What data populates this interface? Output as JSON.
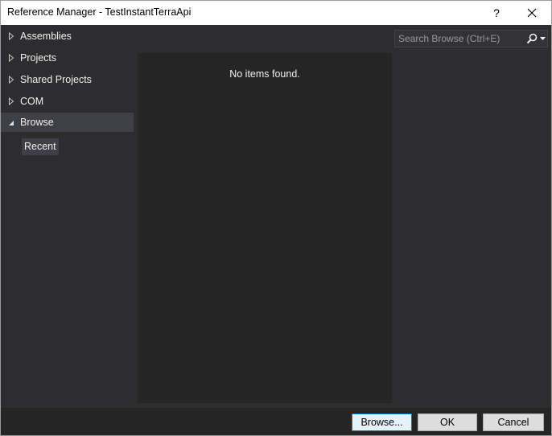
{
  "window": {
    "title": "Reference Manager - TestInstantTerraApi",
    "help_label": "?"
  },
  "tree": {
    "items": [
      {
        "label": "Assemblies",
        "expanded": false
      },
      {
        "label": "Projects",
        "expanded": false
      },
      {
        "label": "Shared Projects",
        "expanded": false
      },
      {
        "label": "COM",
        "expanded": false
      },
      {
        "label": "Browse",
        "expanded": true,
        "selected": true
      }
    ],
    "sub_items": [
      {
        "label": "Recent"
      }
    ]
  },
  "list": {
    "empty_message": "No items found."
  },
  "search": {
    "placeholder": "Search Browse (Ctrl+E)",
    "value": ""
  },
  "footer": {
    "browse_label": "Browse...",
    "ok_label": "OK",
    "cancel_label": "Cancel"
  },
  "colors": {
    "background": "#2d2d30",
    "list_background": "#252526",
    "selection": "#3f3f46",
    "text": "#f1f1f1",
    "focus_border": "#0078d7"
  },
  "icons": {
    "collapsed": "triangle-right-outline-icon",
    "expanded": "triangle-down-filled-icon",
    "search": "search-icon",
    "close": "close-icon"
  }
}
